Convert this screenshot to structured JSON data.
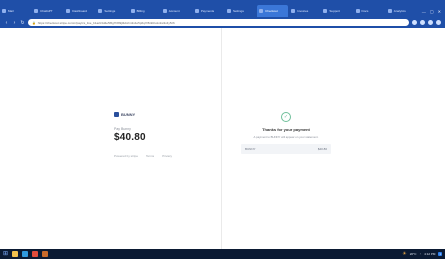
{
  "browser": {
    "tabs": [
      {
        "label": "Mail"
      },
      {
        "label": "ChatGPT"
      },
      {
        "label": "Dashboard"
      },
      {
        "label": "Settings"
      },
      {
        "label": "Billing"
      },
      {
        "label": "Account"
      },
      {
        "label": "Payments"
      },
      {
        "label": "Settings"
      },
      {
        "label": "Checkout",
        "active": true
      },
      {
        "label": "Invoices"
      },
      {
        "label": "Support"
      },
      {
        "label": "Docs"
      },
      {
        "label": "Analytics"
      }
    ],
    "window_controls": {
      "minimize": "—",
      "maximize": "▢",
      "close": "✕"
    },
    "address": "https://checkout.stripe.com/c/pay/cs_live_b1a2c3d4e5f6g7h8i9j0k1l2m3n4o5p6q7r8s9t0u1v2w3x4y5z6"
  },
  "left_panel": {
    "brand": "BUNNY",
    "pay_label": "Pay Bunny",
    "amount": "$40.80",
    "footer_powered": "Powered by stripe",
    "footer_terms": "Terms",
    "footer_privacy": "Privacy"
  },
  "right_panel": {
    "title": "Thanks for your payment",
    "subtitle": "A payment to BUNNY will appear on your statement.",
    "receipt_label": "BUNNY",
    "receipt_value": "$40.80"
  },
  "taskbar": {
    "apps": [
      {
        "name": "file-explorer",
        "color": "#f2c14e"
      },
      {
        "name": "edge",
        "color": "#2f9ae0"
      },
      {
        "name": "chrome",
        "color": "#e24c3b"
      },
      {
        "name": "app",
        "color": "#c96a2b"
      }
    ],
    "weather": "20°C",
    "time": "4:12 PM",
    "notifications": "1"
  }
}
